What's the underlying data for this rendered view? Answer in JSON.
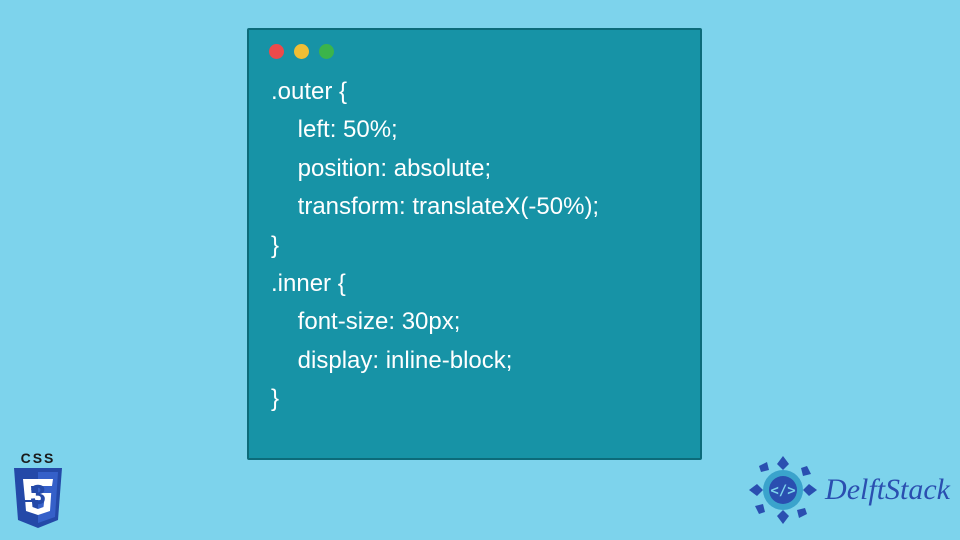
{
  "colors": {
    "background": "#7dd3ec",
    "windowBg": "#1793a6",
    "dotRed": "#ec4a4a",
    "dotYellow": "#f0be35",
    "dotGreen": "#3bb44b",
    "cssShield": "#2449a8",
    "delftBlue": "#2a4fb0"
  },
  "cssLogo": {
    "label": "CSS",
    "number": "3"
  },
  "delftLogo": {
    "text": "DelftStack"
  },
  "code": {
    "lines": [
      ".outer {",
      "    left: 50%;",
      "    position: absolute;",
      "    transform: translateX(-50%);",
      "}",
      ".inner {",
      "    font-size: 30px;",
      "    display: inline-block;",
      "}"
    ]
  }
}
